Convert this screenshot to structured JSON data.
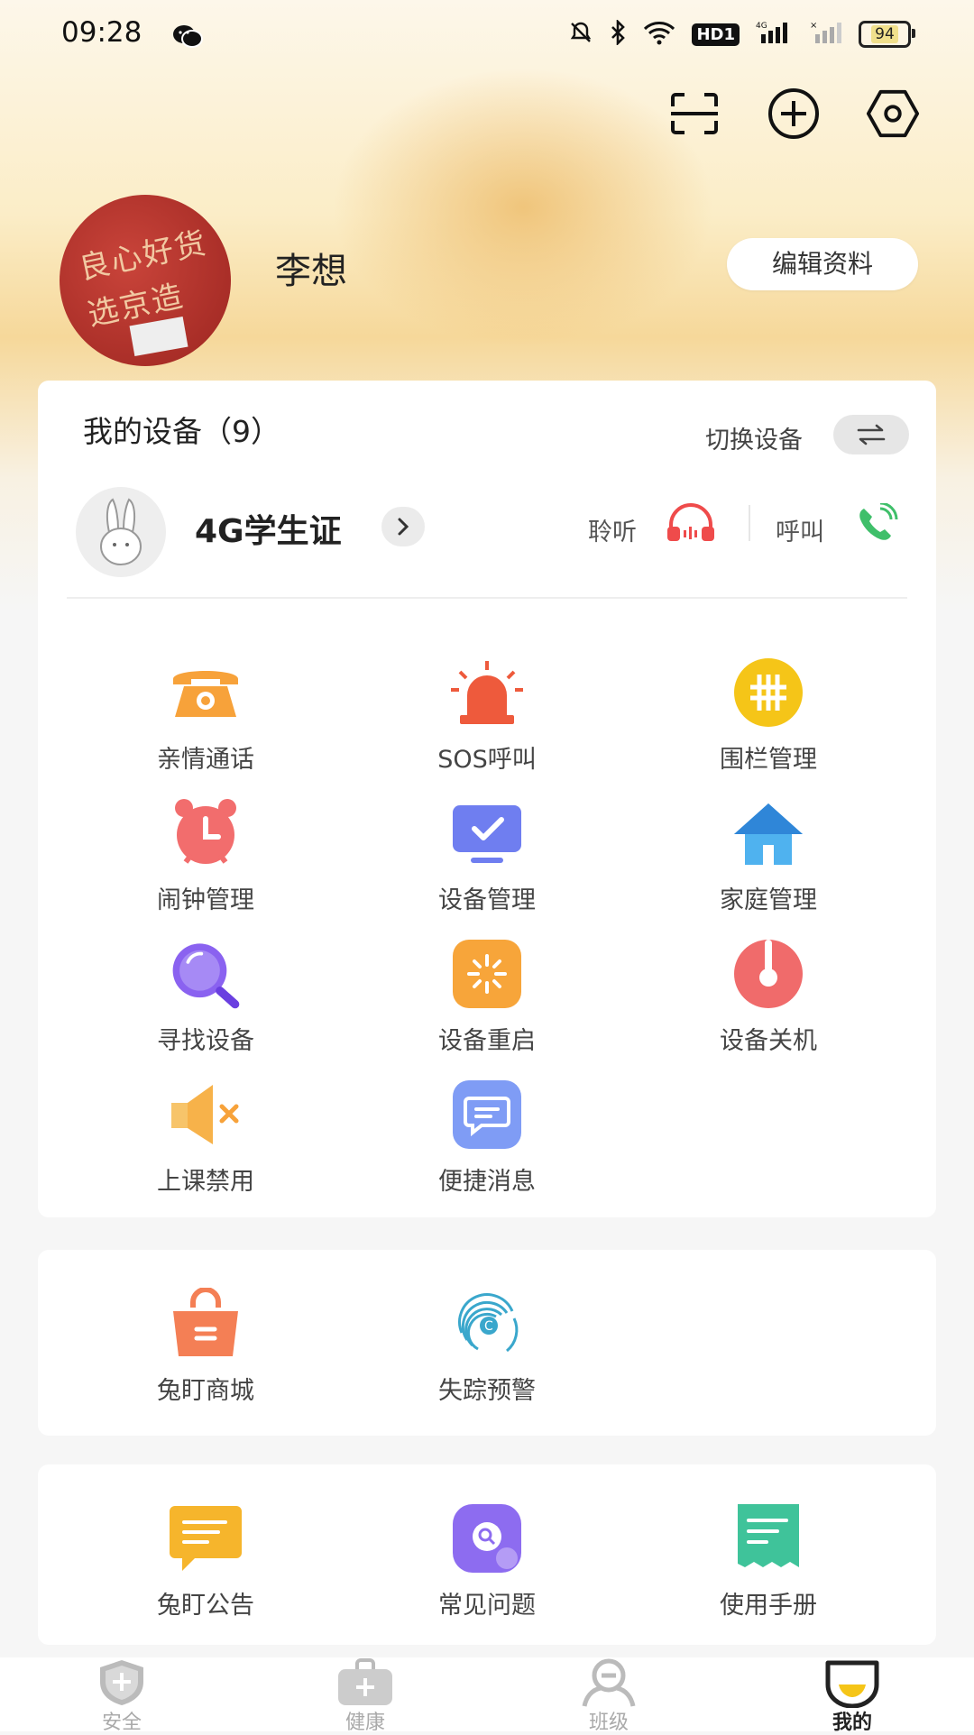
{
  "status_bar": {
    "time": "09:28",
    "battery": "94",
    "hd": "HD1"
  },
  "profile": {
    "name": "李想",
    "edit_label": "编辑资料",
    "avatar_text_1": "良心好货",
    "avatar_text_2": "选京造"
  },
  "devices": {
    "title": "我的设备（9）",
    "switch_label": "切换设备",
    "current_device": "4G学生证",
    "listen_label": "聆听",
    "call_label": "呼叫"
  },
  "features": [
    {
      "label": "亲情通话",
      "icon": "phone-icon",
      "color": "#f7a23a"
    },
    {
      "label": "SOS呼叫",
      "icon": "alarm-siren-icon",
      "color": "#ee5a3c"
    },
    {
      "label": "围栏管理",
      "icon": "fence-icon",
      "color": "#f5c518"
    },
    {
      "label": "闹钟管理",
      "icon": "alarm-clock-icon",
      "color": "#f26d6d"
    },
    {
      "label": "设备管理",
      "icon": "monitor-check-icon",
      "color": "#6f7ef0"
    },
    {
      "label": "家庭管理",
      "icon": "home-icon",
      "color": "#4fb2ef"
    },
    {
      "label": "寻找设备",
      "icon": "magnifier-icon",
      "color": "#8a62f0"
    },
    {
      "label": "设备重启",
      "icon": "restart-icon",
      "color": "#f7a53a"
    },
    {
      "label": "设备关机",
      "icon": "power-icon",
      "color": "#f06b6b"
    },
    {
      "label": "上课禁用",
      "icon": "mute-icon",
      "color": "#f7b24a"
    },
    {
      "label": "便捷消息",
      "icon": "message-icon",
      "color": "#7f9cf5"
    }
  ],
  "services": [
    {
      "label": "兔盯商城",
      "icon": "shopping-bag-icon",
      "color": "#f47f55"
    },
    {
      "label": "失踪预警",
      "icon": "fingerprint-icon",
      "color": "#3aa7cc"
    }
  ],
  "help": [
    {
      "label": "兔盯公告",
      "icon": "announcement-icon",
      "color": "#f6b52c"
    },
    {
      "label": "常见问题",
      "icon": "faq-icon",
      "color": "#8d6cf0"
    },
    {
      "label": "使用手册",
      "icon": "manual-icon",
      "color": "#3fc39a"
    }
  ],
  "tabs": [
    {
      "label": "安全",
      "icon": "shield-plus-icon"
    },
    {
      "label": "健康",
      "icon": "medical-kit-icon"
    },
    {
      "label": "班级",
      "icon": "class-icon"
    },
    {
      "label": "我的",
      "icon": "me-icon",
      "active": true
    }
  ]
}
